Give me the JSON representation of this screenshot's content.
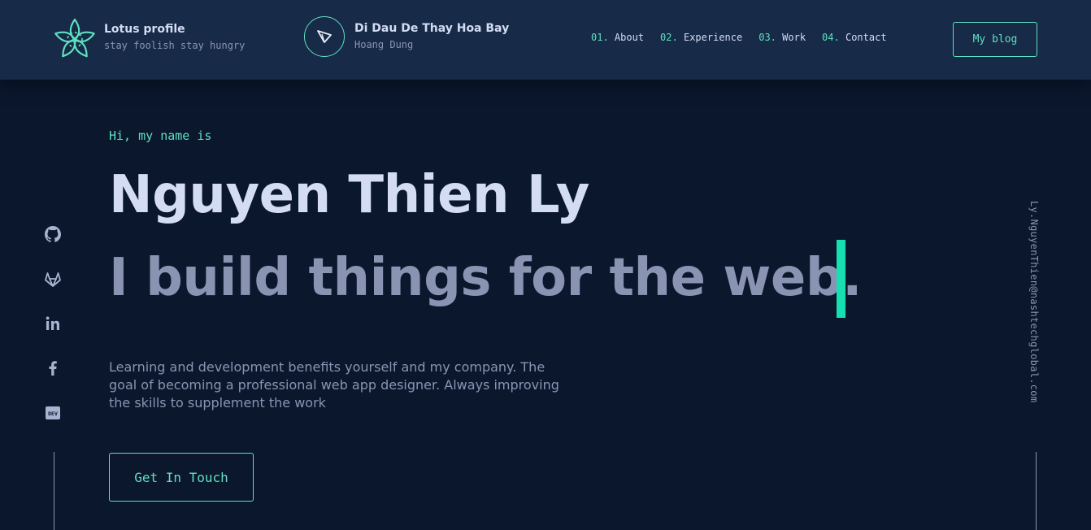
{
  "header": {
    "brands": [
      {
        "title": "Lotus profile",
        "subtitle": "stay foolish stay hungry",
        "icon": "lotus-logo-icon"
      },
      {
        "title": "Di Dau De Thay Hoa Bay",
        "subtitle": "Hoang Dung",
        "icon": "paper-plane-icon"
      }
    ],
    "nav": [
      {
        "num": "01.",
        "label": "About"
      },
      {
        "num": "02.",
        "label": "Experience"
      },
      {
        "num": "03.",
        "label": "Work"
      },
      {
        "num": "04.",
        "label": "Contact"
      }
    ],
    "blog_button": "My blog"
  },
  "hero": {
    "greeting": "Hi, my name is",
    "name": "Nguyen Thien Ly",
    "tagline": "I build things for the web.",
    "intro": "Learning and development benefits yourself and my company. The goal of becoming a professional web app designer. Always improving the skills to supplement the work",
    "cta": "Get In Touch"
  },
  "social": [
    {
      "icon": "github-icon"
    },
    {
      "icon": "gitlab-icon"
    },
    {
      "icon": "linkedin-icon"
    },
    {
      "icon": "facebook-icon"
    },
    {
      "icon": "dev-icon"
    }
  ],
  "email": "Ly.NguyenThien@nashtechglobal.com",
  "colors": {
    "background": "#0b172d",
    "header": "#172a47",
    "accent": "#5fe0c0",
    "cursor": "#16e0b2",
    "text_light": "#d3dcf3",
    "text_muted": "#8a94b2"
  }
}
